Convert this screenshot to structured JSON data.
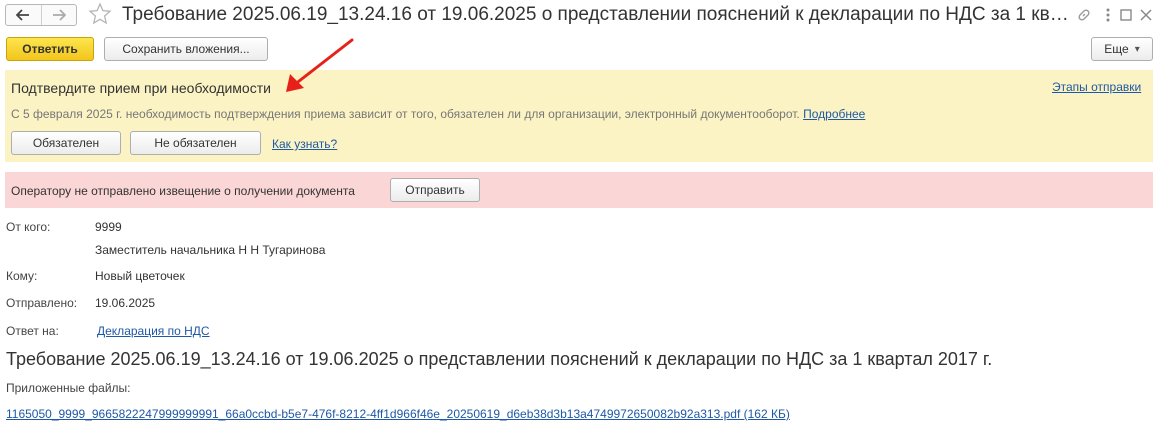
{
  "window": {
    "title": "Требование 2025.06.19_13.24.16 от 19.06.2025 о представлении пояснений к декларации по НДС за 1 кв…"
  },
  "toolbar": {
    "reply_label": "Ответить",
    "save_attachments_label": "Сохранить вложения...",
    "more_label": "Еще",
    "more_chevron": "▾"
  },
  "confirm_panel": {
    "title": "Подтвердите прием при необходимости",
    "stages_link": "Этапы отправки",
    "description": "С 5 февраля 2025 г. необходимость подтверждения приема зависит от того, обязателен ли для организации, электронный документооборот.",
    "more_link": "Подробнее",
    "required_label": "Обязателен",
    "not_required_label": "Не обязателен",
    "how_to_know_link": "Как узнать?"
  },
  "notice_panel": {
    "text": "Оператору не отправлено извещение о получении документа",
    "send_label": "Отправить"
  },
  "details": {
    "from_label": "От кого:",
    "from_code": "9999",
    "from_name": "Заместитель начальника Н Н Тугаринова",
    "to_label": "Кому:",
    "to_value": "Новый цветочек",
    "sent_label": "Отправлено:",
    "sent_value": "19.06.2025",
    "reply_to_label": "Ответ на:",
    "reply_to_link": "Декларация по НДС"
  },
  "document": {
    "heading": "Требование 2025.06.19_13.24.16 от 19.06.2025 о представлении пояснений к декларации по НДС за 1 квартал 2017 г.",
    "attachments_label": "Приложенные файлы:",
    "attachment_link": "1165050_9999_9665822247999999991_66a0ccbd-b5e7-476f-8212-4ff1d966f46e_20250619_d6eb38d3b13a4749972650082b92a313.pdf (162 КБ)"
  },
  "colors": {
    "accent_yellow": "#f5cb1f",
    "panel_yellow": "#fbf3c3",
    "panel_red": "#fbd6d6",
    "link_blue": "#1e58a6",
    "annotation_arrow": "#e8201a"
  },
  "icons": [
    "back-arrow-icon",
    "forward-arrow-icon",
    "favorite-star-icon",
    "link-icon",
    "more-vertical-icon",
    "maximize-icon",
    "close-icon",
    "annotation-arrow-icon"
  ]
}
